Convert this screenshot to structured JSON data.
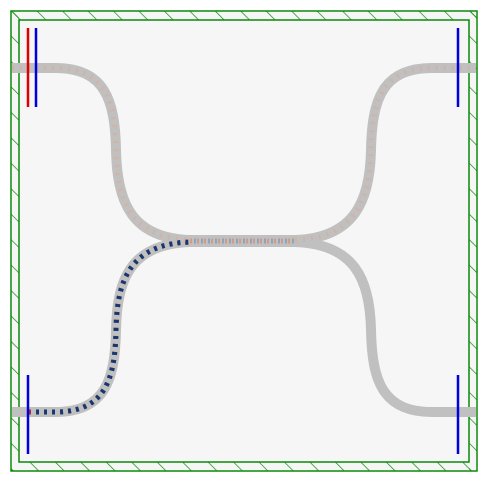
{
  "colors": {
    "background": "#f6f6f6",
    "waveguide": "#c0c0c0",
    "field_positive": "#b22222",
    "field_negative": "#0b3a78",
    "pml_border": "#0a8a0a",
    "source": "#e00000",
    "monitor": "#0000dd"
  },
  "structure": {
    "type": "directional-coupler",
    "ports": [
      "top-left",
      "bottom-left",
      "top-right",
      "bottom-right"
    ],
    "excited_port": "bottom-left"
  },
  "elements": {
    "source": "source-plane",
    "monitors": [
      "monitor-top-left",
      "monitor-bottom-left",
      "monitor-top-right",
      "monitor-bottom-right"
    ],
    "boundary": "pml-hatched-frame"
  }
}
